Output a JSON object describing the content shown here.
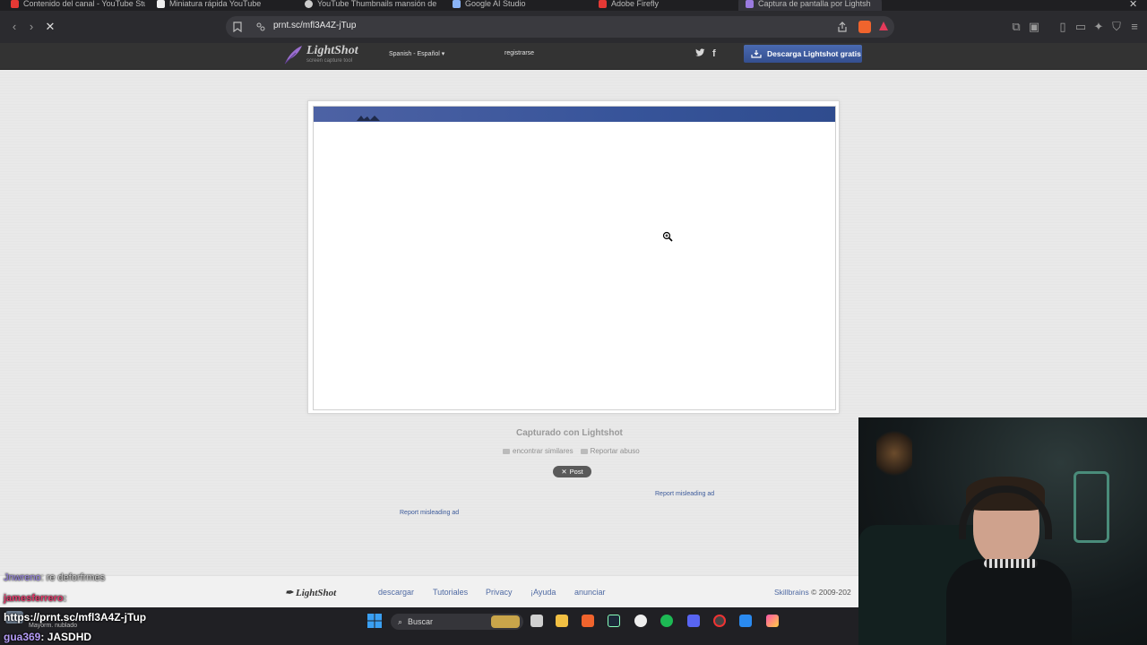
{
  "browser": {
    "tabs": [
      {
        "label": "Contenido del canal - YouTube Stud",
        "color": "#e53935"
      },
      {
        "label": "Miniatura rápida YouTube",
        "color": "#eeeeee"
      },
      {
        "label": "YouTube Thumbnails mansión de Ep",
        "color": "#cccccc"
      },
      {
        "label": "Google AI Studio",
        "color": "#8ab4f8"
      },
      {
        "label": "Adobe Firefly",
        "color": "#e53935"
      },
      {
        "label": "Captura de pantalla por Lightsh",
        "color": "#9b7be0"
      }
    ],
    "url": "prnt.sc/mfl3A4Z-jTup"
  },
  "header": {
    "logo_name": "LightShot",
    "logo_tagline": "screen capture tool",
    "language": "Spanish - Español",
    "register": "registrarse",
    "download_button": "Descarga Lightshot gratis"
  },
  "main": {
    "captured_with": "Capturado con Lightshot",
    "find_similar": "encontrar similares",
    "report_abuse": "Reportar abuso",
    "post_button": "Post",
    "report_ad_1": "Report misleading ad",
    "report_ad_2": "Report misleading ad"
  },
  "footer": {
    "logo": "LightShot",
    "links": [
      "descargar",
      "Tutoriales",
      "Privacy",
      "¡Ayuda",
      "anunciar"
    ],
    "company": "Skillbrains",
    "copyright": "© 2009-202"
  },
  "chat": {
    "line1_user": "Jnwreno",
    "line1_text": ": re deforfrmes",
    "line2_user": "jamesferrero",
    "line2_text": ":",
    "line3_text": "https://prnt.sc/mfl3A4Z-jTup",
    "line4_user": "gua369",
    "line4_text": ": JASDHD"
  },
  "taskbar": {
    "weather": "Mayorm. nublado",
    "search_placeholder": "Buscar"
  }
}
